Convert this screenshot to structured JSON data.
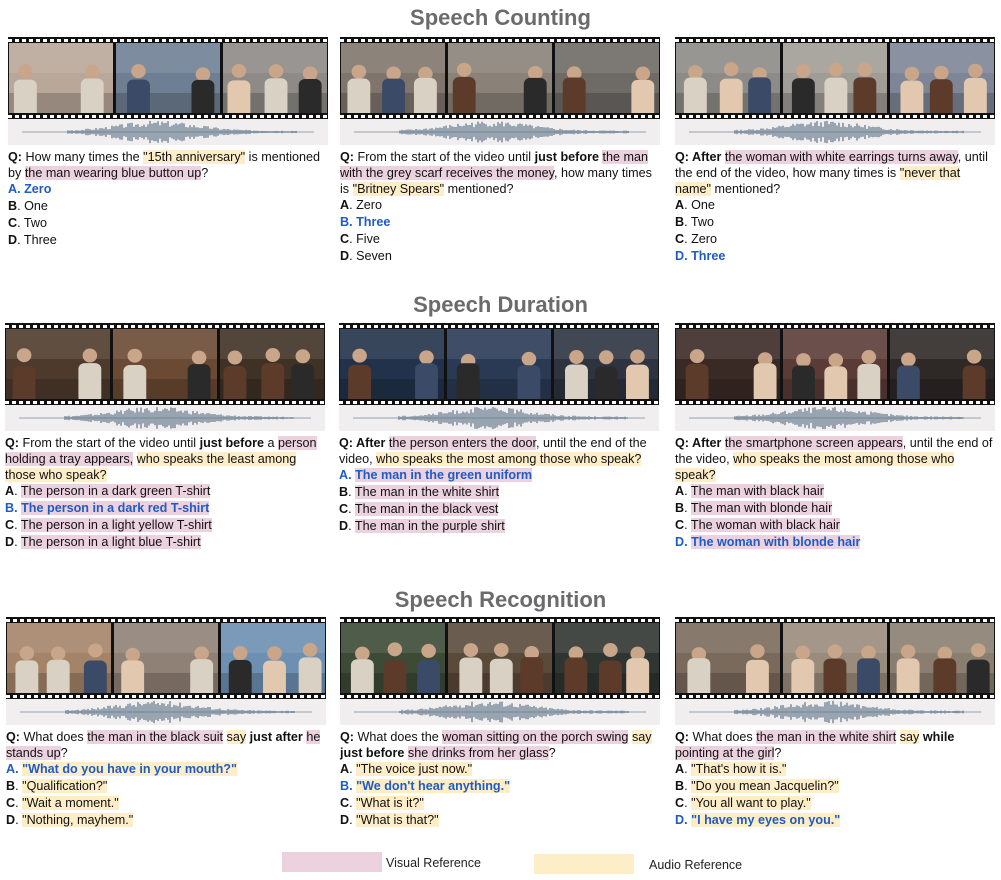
{
  "sections": [
    {
      "title": "Speech Counting",
      "cards": [
        {
          "palette": [
            "#b9a79a",
            "#6f7f93",
            "#8d8a87"
          ],
          "question": [
            {
              "t": "Q: ",
              "b": true
            },
            {
              "t": "How many times the "
            },
            {
              "t": "\"15th anniversary\"",
              "h": "aud"
            },
            {
              "t": " is mentioned by "
            },
            {
              "t": "the man wearing blue button up",
              "h": "vis"
            },
            {
              "t": "?"
            }
          ],
          "options": [
            {
              "letter": "A",
              "sep": ". ",
              "text": "Zero",
              "correct": true
            },
            {
              "letter": "B",
              "sep": ". ",
              "text": "One"
            },
            {
              "letter": "C",
              "sep": ". ",
              "text": "Two"
            },
            {
              "letter": "D",
              "sep": ". ",
              "text": "Three"
            }
          ]
        },
        {
          "palette": [
            "#7f756c",
            "#8a8279",
            "#6e6a66"
          ],
          "question": [
            {
              "t": "Q: ",
              "b": true
            },
            {
              "t": "From the start of the video until "
            },
            {
              "t": "just before",
              "b": true
            },
            {
              "t": " "
            },
            {
              "t": "the man with the grey scarf receives the money",
              "h": "vis"
            },
            {
              "t": ", how many times is "
            },
            {
              "t": "\"Britney Spears\"",
              "h": "aud"
            },
            {
              "t": " mentioned?"
            }
          ],
          "options": [
            {
              "letter": "A",
              "sep": ". ",
              "text": "Zero"
            },
            {
              "letter": "B",
              "sep": ". ",
              "text": "Three",
              "correct": true
            },
            {
              "letter": "C",
              "sep": ". ",
              "text": "Five"
            },
            {
              "letter": "D",
              "sep": ". ",
              "text": "Seven"
            }
          ]
        },
        {
          "palette": [
            "#8c8b87",
            "#a09d96",
            "#7d8597"
          ],
          "question": [
            {
              "t": "Q: ",
              "b": true
            },
            {
              "t": "After",
              "b": true
            },
            {
              "t": " "
            },
            {
              "t": "the woman with white earrings turns away",
              "h": "vis"
            },
            {
              "t": ", until the end of the video, how many times is "
            },
            {
              "t": "\"never that name\"",
              "h": "aud"
            },
            {
              "t": " mentioned?"
            }
          ],
          "options": [
            {
              "letter": "A",
              "sep": ". ",
              "text": "One"
            },
            {
              "letter": "B",
              "sep": ". ",
              "text": "Two"
            },
            {
              "letter": "C",
              "sep": ". ",
              "text": "Zero"
            },
            {
              "letter": "D",
              "sep": ". ",
              "text": "Three",
              "correct": true
            }
          ]
        }
      ]
    },
    {
      "title": "Speech Duration",
      "cards": [
        {
          "palette": [
            "#4e3a2c",
            "#6a4a33",
            "#3f3124"
          ],
          "question": [
            {
              "t": "Q: ",
              "b": true
            },
            {
              "t": "From the start of the video until "
            },
            {
              "t": "just before",
              "b": true
            },
            {
              "t": " a "
            },
            {
              "t": "person holding a tray appears,",
              "h": "vis"
            },
            {
              "t": " "
            },
            {
              "t": "who speaks the least among those who speak?",
              "h": "aud"
            }
          ],
          "options": [
            {
              "letter": "A",
              "sep": ". ",
              "text": "The person in a dark green T-shirt",
              "h": "vis"
            },
            {
              "letter": "B",
              "sep": ". ",
              "text": "The person in a dark red T-shirt",
              "h": "vis",
              "correct": true
            },
            {
              "letter": "C",
              "sep": ". ",
              "text": "The person in a light yellow T-shirt",
              "h": "vis"
            },
            {
              "letter": "D",
              "sep": ". ",
              "text": "The person in a light blue T-shirt",
              "h": "vis"
            }
          ]
        },
        {
          "palette": [
            "#22324a",
            "#2a3a55",
            "#2d3440"
          ],
          "question": [
            {
              "t": "Q: ",
              "b": true
            },
            {
              "t": "After",
              "b": true
            },
            {
              "t": " "
            },
            {
              "t": "the person enters the door",
              "h": "vis"
            },
            {
              "t": ", until the end of the video, "
            },
            {
              "t": "who speaks the most among those who speak?",
              "h": "aud"
            }
          ],
          "options": [
            {
              "letter": "A",
              "sep": ". ",
              "text": "The man in the green uniform",
              "h": "vis",
              "correct": true
            },
            {
              "letter": "B",
              "sep": ". ",
              "text": "The man in the white shirt",
              "h": "vis"
            },
            {
              "letter": "C",
              "sep": ". ",
              "text": "The man in the black vest",
              "h": "vis"
            },
            {
              "letter": "D",
              "sep": ". ",
              "text": "The man in the purple shirt",
              "h": "vis"
            }
          ]
        },
        {
          "palette": [
            "#3a2a26",
            "#5a3b36",
            "#2e2826"
          ],
          "question": [
            {
              "t": "Q: ",
              "b": true
            },
            {
              "t": "After",
              "b": true
            },
            {
              "t": " "
            },
            {
              "t": "the smartphone screen appears",
              "h": "vis"
            },
            {
              "t": ", until the end of the video, "
            },
            {
              "t": "who speaks the most among those who speak?",
              "h": "aud"
            }
          ],
          "options": [
            {
              "letter": "A",
              "sep": ". ",
              "text": "The man with black hair",
              "h": "vis"
            },
            {
              "letter": "B",
              "sep": ". ",
              "text": "The man with blonde hair",
              "h": "vis"
            },
            {
              "letter": "C",
              "sep": ". ",
              "text": "The woman with black hair",
              "h": "vis"
            },
            {
              "letter": "D",
              "sep": ". ",
              "text": "The woman with blonde hair",
              "h": "vis",
              "correct": true
            }
          ]
        }
      ]
    },
    {
      "title": "Speech Recognition",
      "cards": [
        {
          "palette": [
            "#a48468",
            "#8f8176",
            "#6d8fb2"
          ],
          "question": [
            {
              "t": "Q: ",
              "b": true
            },
            {
              "t": "What does "
            },
            {
              "t": "the man in the black suit",
              "h": "vis"
            },
            {
              "t": " "
            },
            {
              "t": "say",
              "h": "aud"
            },
            {
              "t": " "
            },
            {
              "t": "just after",
              "b": true
            },
            {
              "t": " "
            },
            {
              "t": "he stands up",
              "h": "vis"
            },
            {
              "t": "?"
            }
          ],
          "options": [
            {
              "letter": "A",
              "sep": ". ",
              "text": "\"What do you have in your mouth?\"",
              "h": "aud",
              "correct": true
            },
            {
              "letter": "B",
              "sep": ". ",
              "text": "\"Qualification?\"",
              "h": "aud"
            },
            {
              "letter": "C",
              "sep": ". ",
              "text": "\"Wait a moment.\"",
              "h": "aud"
            },
            {
              "letter": "D",
              "sep": ". ",
              "text": "\"Nothing, mayhem.\"",
              "h": "aud"
            }
          ]
        },
        {
          "palette": [
            "#3d4a36",
            "#5a4a3a",
            "#2f3530"
          ],
          "question": [
            {
              "t": "Q: ",
              "b": true
            },
            {
              "t": "What does the "
            },
            {
              "t": "woman sitting on the porch swing",
              "h": "vis"
            },
            {
              "t": " "
            },
            {
              "t": "say",
              "h": "aud"
            },
            {
              "t": " "
            },
            {
              "t": "just before",
              "b": true
            },
            {
              "t": " "
            },
            {
              "t": "she drinks from her glass",
              "h": "vis"
            },
            {
              "t": "?"
            }
          ],
          "options": [
            {
              "letter": "A",
              "sep": ". ",
              "text": "\"The voice just now.\"",
              "h": "aud"
            },
            {
              "letter": "B",
              "sep": ". ",
              "text": "\"We don't hear anything.\"",
              "h": "aud",
              "correct": true
            },
            {
              "letter": "C",
              "sep": ". ",
              "text": "\"What is it?\"",
              "h": "aud"
            },
            {
              "letter": "D",
              "sep": ". ",
              "text": "\"What is that?\"",
              "h": "aud"
            }
          ]
        },
        {
          "palette": [
            "#7a6a5c",
            "#9a8c7c",
            "#8a7e70"
          ],
          "question": [
            {
              "t": "Q: ",
              "b": true
            },
            {
              "t": "What does "
            },
            {
              "t": "the man in the white shirt",
              "h": "vis"
            },
            {
              "t": " "
            },
            {
              "t": "say",
              "h": "aud"
            },
            {
              "t": " "
            },
            {
              "t": "while",
              "b": true
            },
            {
              "t": " "
            },
            {
              "t": "pointing at the girl",
              "h": "vis"
            },
            {
              "t": "?"
            }
          ],
          "options": [
            {
              "letter": "A",
              "sep": ". ",
              "text": "\"That's how it is.\"",
              "h": "aud"
            },
            {
              "letter": "B",
              "sep": ". ",
              "text": "\"Do you mean Jacquelin?\"",
              "h": "aud"
            },
            {
              "letter": "C",
              "sep": ". ",
              "text": "\"You all want to play.\"",
              "h": "aud"
            },
            {
              "letter": "D",
              "sep": ". ",
              "text": "\"I have my eyes on you.\"",
              "h": "aud",
              "correct": true
            }
          ]
        }
      ]
    }
  ],
  "legend": {
    "visual_label": "Visual Reference",
    "audio_label": "Audio Reference",
    "visual_color": "#ecd2df",
    "audio_color": "#fdeec8"
  },
  "colors": {
    "correct": "#1f5bc4",
    "title": "#6b6b6b"
  }
}
